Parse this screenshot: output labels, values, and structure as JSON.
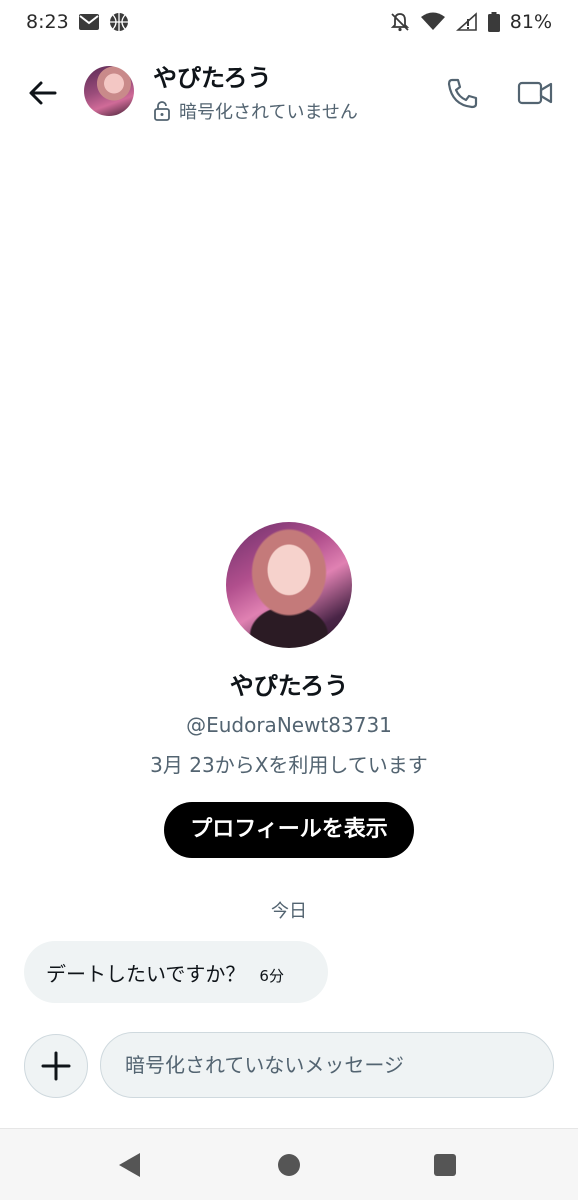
{
  "status_bar": {
    "time": "8:23",
    "battery": "81%",
    "icons_left": [
      "mail-icon",
      "basketball-icon"
    ],
    "icons_right": [
      "muted-bell-icon",
      "wifi-icon",
      "signal-icon",
      "battery-icon"
    ]
  },
  "header": {
    "contact_name": "やぴたろう",
    "encryption_status": "暗号化されていません",
    "icons": [
      "back-arrow-icon",
      "lock-open-icon",
      "phone-icon",
      "video-icon"
    ]
  },
  "profile": {
    "name": "やぴたろう",
    "handle": "@EudoraNewt83731",
    "joined": "3月 23からXを利用しています",
    "view_profile_label": "プロフィールを表示"
  },
  "conversation": {
    "day_label": "今日",
    "messages": [
      {
        "text": "デートしたいですか？",
        "time": "6分"
      }
    ]
  },
  "composer": {
    "placeholder": "暗号化されていないメッセージ",
    "value": ""
  },
  "colors": {
    "text_primary": "#0f1419",
    "text_secondary": "#536471",
    "bubble_bg": "#eff3f4",
    "button_bg": "#000000"
  }
}
